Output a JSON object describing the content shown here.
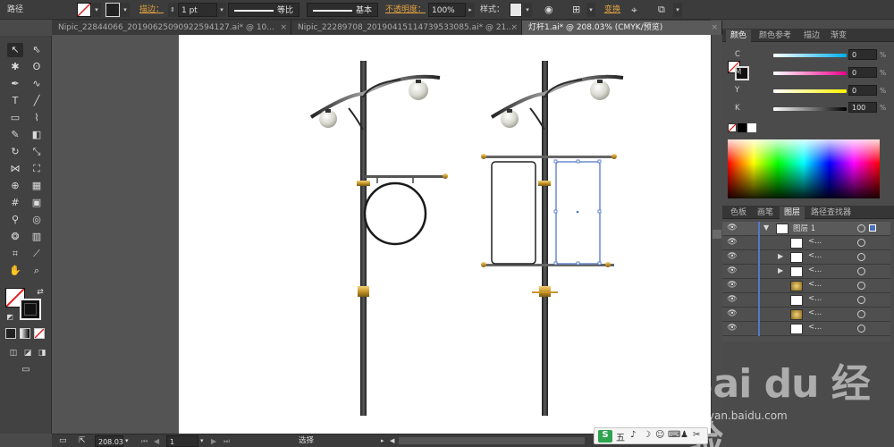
{
  "controlbar": {
    "object_type": "路径",
    "stroke_label": "描边：",
    "stroke_width": "1 pt",
    "profile_label": "等比",
    "brush_label": "基本",
    "opacity_label": "不透明度：",
    "opacity_value": "100%",
    "style_label": "样式：",
    "transform_label": "变换"
  },
  "tabs": [
    {
      "label": "Nipic_22844066_20190625090922594127.ai* @ 10..."
    },
    {
      "label": "Nipic_22289708_20190415114739533085.ai* @ 21..."
    },
    {
      "label": "灯杆1.ai* @ 208.03% (CMYK/预览)"
    }
  ],
  "statusbar": {
    "zoom": "208.03",
    "page": "1",
    "tool_status": "选择"
  },
  "color_panel": {
    "tabs": [
      "颜色",
      "颜色参考",
      "描边",
      "渐变"
    ],
    "channels": [
      {
        "label": "C",
        "value": "0",
        "unit": "%"
      },
      {
        "label": "M",
        "value": "0",
        "unit": "%"
      },
      {
        "label": "Y",
        "value": "0",
        "unit": "%"
      },
      {
        "label": "K",
        "value": "100",
        "unit": "%"
      }
    ]
  },
  "layers_panel": {
    "tabs": [
      "色板",
      "画笔",
      "图层",
      "路径查找器"
    ],
    "layer_name": "图层 1",
    "sublayers": [
      "<...",
      "<...",
      "<...",
      "<...",
      "<...",
      "<...",
      "<..."
    ]
  },
  "ime": {
    "label": "五"
  },
  "watermark": {
    "logo": "Bai du 经验",
    "url": "jingyan.baidu.com"
  },
  "colors": {
    "accent": "#e0a040",
    "canvas_bg": "#545454",
    "artboard": "#ffffff",
    "pole": "#3a3a3a",
    "gold": "#c8962a"
  }
}
